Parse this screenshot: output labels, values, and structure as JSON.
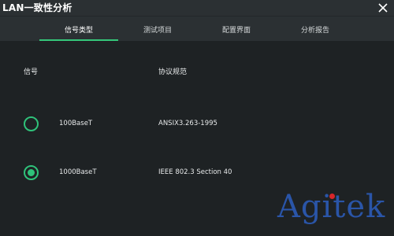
{
  "window": {
    "title": "LAN一致性分析"
  },
  "tabs": [
    {
      "label": "信号类型",
      "active": true
    },
    {
      "label": "测试项目",
      "active": false
    },
    {
      "label": "配置界面",
      "active": false
    },
    {
      "label": "分析报告",
      "active": false
    }
  ],
  "table": {
    "headers": {
      "signal": "信号",
      "protocol": "协议规范"
    },
    "rows": [
      {
        "name": "100BaseT",
        "protocol": "ANSIX3.263-1995",
        "selected": false
      },
      {
        "name": "1000BaseT",
        "protocol": "IEEE 802.3 Section 40",
        "selected": true
      }
    ]
  },
  "watermark": {
    "text": "Agitek"
  },
  "colors": {
    "accent": "#35c77a",
    "background": "#1e2224",
    "bar": "#2b3033",
    "watermark": "#2a55a8",
    "watermark_dot": "#d8262a"
  },
  "icons": {
    "close": "close-icon"
  }
}
